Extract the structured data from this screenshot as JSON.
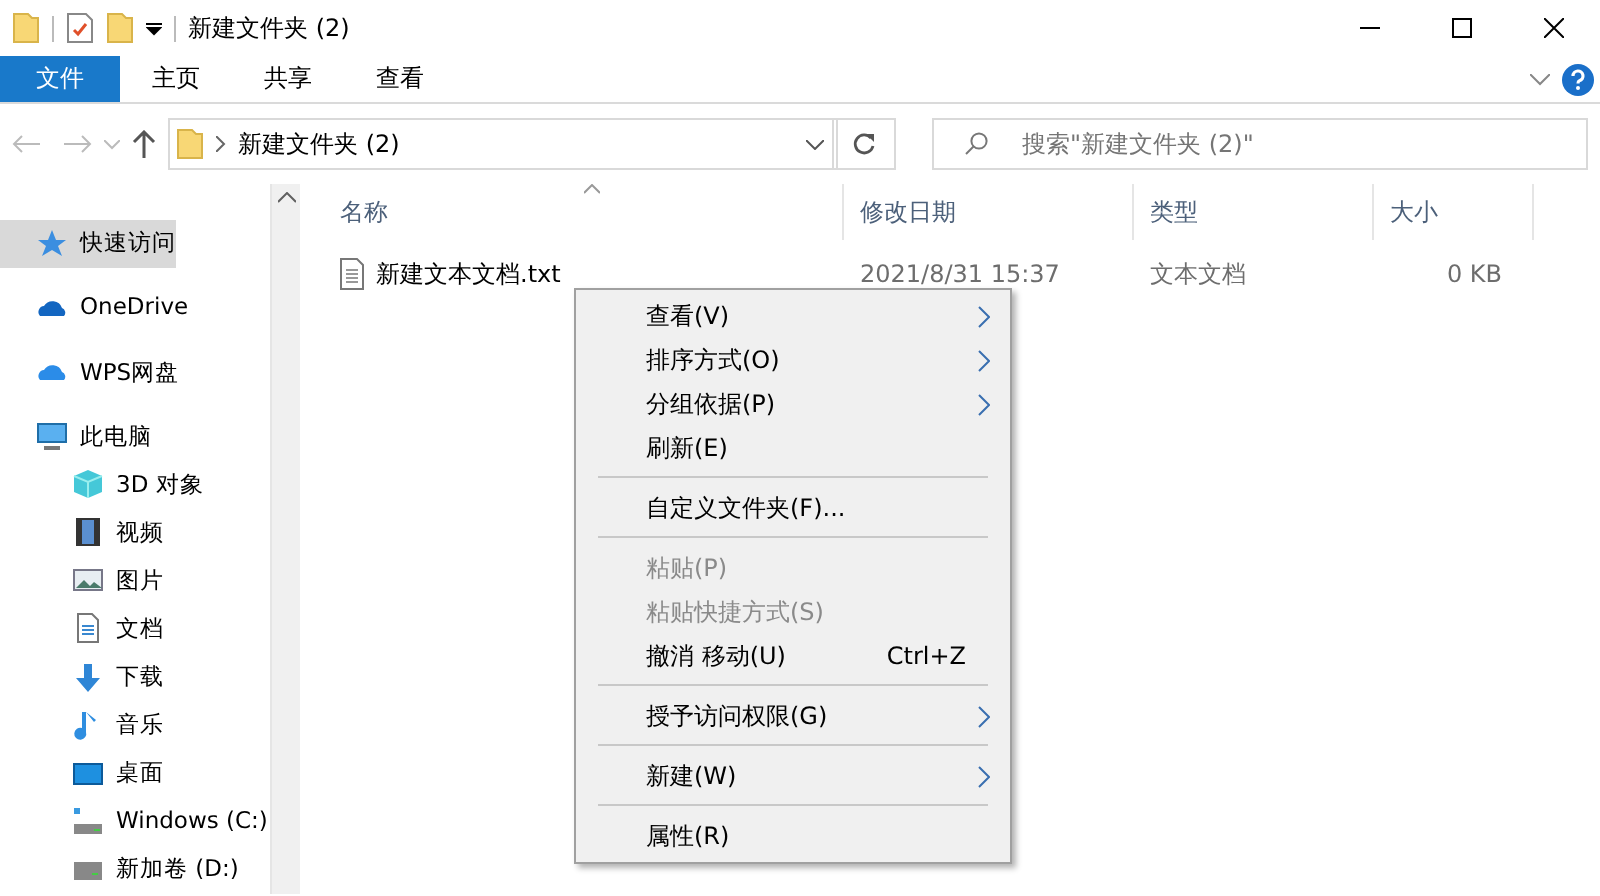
{
  "window": {
    "title": "新建文件夹 (2)"
  },
  "ribbon_tabs": [
    {
      "label": "文件",
      "selected": true
    },
    {
      "label": "主页",
      "selected": false
    },
    {
      "label": "共享",
      "selected": false
    },
    {
      "label": "查看",
      "selected": false
    }
  ],
  "address_bar": {
    "path": "新建文件夹 (2)"
  },
  "search": {
    "placeholder": "搜索\"新建文件夹 (2)\""
  },
  "sidebar": {
    "items": [
      {
        "label": "快速访问",
        "kind": "star",
        "selected": true
      },
      {
        "label": "OneDrive",
        "kind": "cloud",
        "selected": false
      },
      {
        "label": "WPS网盘",
        "kind": "cloud2",
        "selected": false
      },
      {
        "label": "此电脑",
        "kind": "pc",
        "selected": false,
        "children": [
          {
            "label": "3D 对象",
            "kind": "cube",
            "selected": false
          },
          {
            "label": "视频",
            "kind": "film",
            "selected": false
          },
          {
            "label": "图片",
            "kind": "image",
            "selected": false
          },
          {
            "label": "文档",
            "kind": "doc",
            "selected": false
          },
          {
            "label": "下载",
            "kind": "download",
            "selected": false
          },
          {
            "label": "音乐",
            "kind": "music",
            "selected": false
          },
          {
            "label": "桌面",
            "kind": "desktop",
            "selected": false
          },
          {
            "label": "Windows (C:)",
            "kind": "drivec",
            "selected": false
          },
          {
            "label": "新加卷 (D:)",
            "kind": "drive",
            "selected": false
          }
        ]
      }
    ]
  },
  "table": {
    "columns": [
      "名称",
      "修改日期",
      "类型",
      "大小"
    ],
    "rows": [
      [
        "新建文本文档.txt",
        "2021/8/31 15:37",
        "文本文档",
        "0 KB"
      ]
    ]
  },
  "context_menu": [
    {
      "kind": "item",
      "label": "查看(V)",
      "disabled": false,
      "submenu": true
    },
    {
      "kind": "item",
      "label": "排序方式(O)",
      "disabled": false,
      "submenu": true
    },
    {
      "kind": "item",
      "label": "分组依据(P)",
      "disabled": false,
      "submenu": true
    },
    {
      "kind": "item",
      "label": "刷新(E)",
      "disabled": false,
      "submenu": false
    },
    {
      "kind": "separator"
    },
    {
      "kind": "item",
      "label": "自定义文件夹(F)...",
      "disabled": false,
      "submenu": false
    },
    {
      "kind": "separator"
    },
    {
      "kind": "item",
      "label": "粘贴(P)",
      "disabled": true,
      "submenu": false
    },
    {
      "kind": "item",
      "label": "粘贴快捷方式(S)",
      "disabled": true,
      "submenu": false
    },
    {
      "kind": "item",
      "label": "撤消 移动(U)",
      "shortcut": "Ctrl+Z",
      "disabled": false,
      "submenu": false
    },
    {
      "kind": "separator"
    },
    {
      "kind": "item",
      "label": "授予访问权限(G)",
      "disabled": false,
      "submenu": true
    },
    {
      "kind": "separator"
    },
    {
      "kind": "item",
      "label": "新建(W)",
      "disabled": false,
      "submenu": true
    },
    {
      "kind": "separator"
    },
    {
      "kind": "item",
      "label": "属性(R)",
      "disabled": false,
      "submenu": false
    }
  ]
}
